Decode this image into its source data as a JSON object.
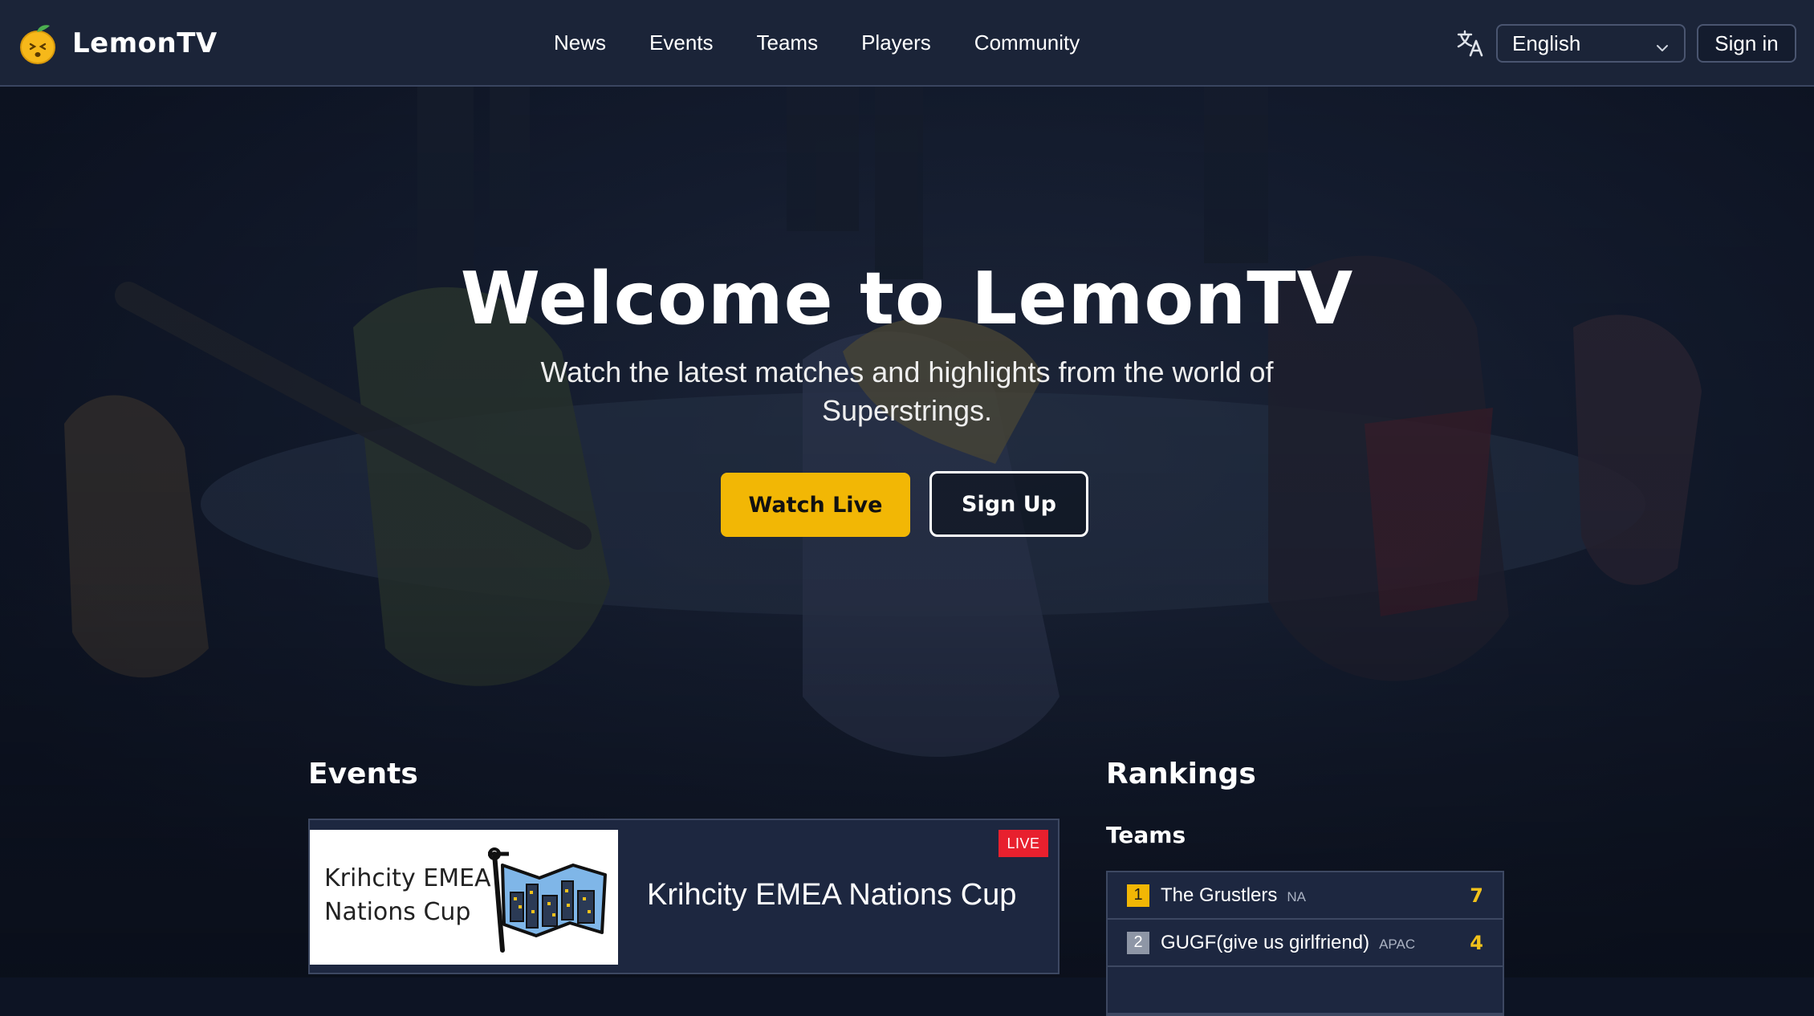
{
  "header": {
    "logo_text": "LemonTV",
    "nav": [
      "News",
      "Events",
      "Teams",
      "Players",
      "Community"
    ],
    "language_selected": "English",
    "sign_in_label": "Sign in",
    "icons": [
      "lemon-logo-icon",
      "translate-icon",
      "chevron-down-icon"
    ]
  },
  "hero": {
    "title": "Welcome to LemonTV",
    "subtitle": "Watch the latest matches and highlights from the world of Superstrings.",
    "watch_live_label": "Watch Live",
    "sign_up_label": "Sign Up"
  },
  "events": {
    "title": "Events",
    "items": [
      {
        "thumb_text": "Krihcity EMEA\nNations Cup",
        "name": "Krihcity EMEA Nations Cup",
        "badge": "LIVE"
      }
    ]
  },
  "rankings": {
    "title": "Rankings",
    "teams_title": "Teams",
    "teams": [
      {
        "rank": "1",
        "name": "The Grustlers",
        "region": "NA",
        "score": "7"
      },
      {
        "rank": "2",
        "name": "GUGF(give us girlfriend)",
        "region": "APAC",
        "score": "4"
      }
    ]
  },
  "colors": {
    "accent": "#f2b705",
    "live_badge": "#e8202e",
    "header_bg": "#1b2438",
    "card_bg": "#1d2740"
  }
}
